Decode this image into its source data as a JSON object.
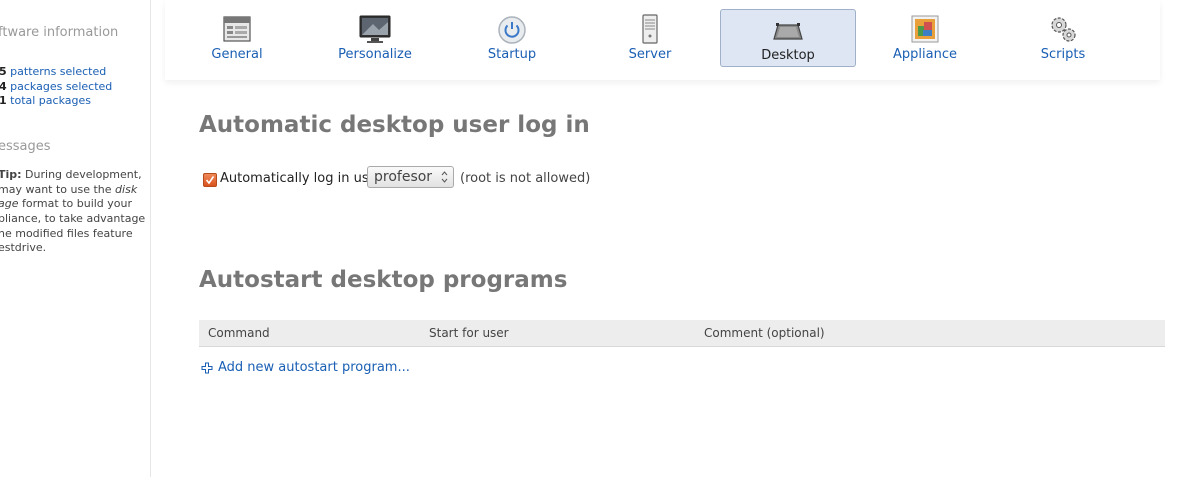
{
  "sidebar": {
    "software_heading": "ftware information",
    "stats": [
      {
        "count": "5",
        "label": "patterns selected"
      },
      {
        "count": "4",
        "label": "packages selected"
      },
      {
        "count": "1",
        "label": "total packages"
      }
    ],
    "messages_heading": "essages",
    "tip": {
      "lead": "Tip:",
      "line1": " During development,",
      "line2a": " may want to use the ",
      "line2b": "disk",
      "line3a": "age",
      "line3b": " format to build your",
      "line4": "pliance, to take advantage",
      "line5": "he modified files feature",
      "line6": "estdrive."
    }
  },
  "tabs": [
    {
      "label": "General",
      "icon": "general-icon",
      "active": false
    },
    {
      "label": "Personalize",
      "icon": "monitor-icon",
      "active": false
    },
    {
      "label": "Startup",
      "icon": "power-icon",
      "active": false
    },
    {
      "label": "Server",
      "icon": "server-icon",
      "active": false
    },
    {
      "label": "Desktop",
      "icon": "desktop-icon",
      "active": true
    },
    {
      "label": "Appliance",
      "icon": "appliance-icon",
      "active": false
    },
    {
      "label": "Scripts",
      "icon": "gears-icon",
      "active": false
    }
  ],
  "main": {
    "login_heading": "Automatic desktop user log in",
    "autologin_label": "Automatically log in user",
    "autologin_checked": true,
    "user_select_value": "profesor",
    "root_note": "(root is not allowed)",
    "autostart_heading": "Autostart desktop programs",
    "table_columns": [
      "Command",
      "Start for user",
      "Comment (optional)"
    ],
    "add_link": "Add new autostart program..."
  },
  "colors": {
    "link": "#1a5fb4",
    "active_tab_bg": "#dde6f2",
    "heading": "#777777",
    "checkbox": "#e0622a"
  }
}
